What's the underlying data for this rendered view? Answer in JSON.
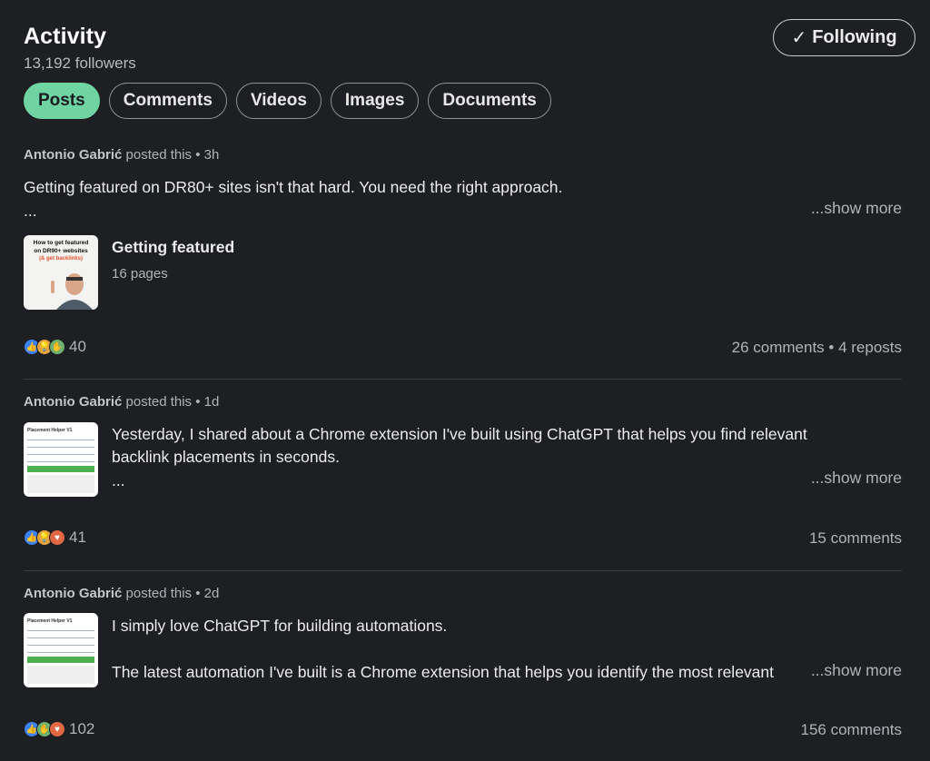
{
  "header": {
    "title": "Activity",
    "followers": "13,192 followers",
    "follow_label": "Following",
    "follow_check": "✓"
  },
  "tabs": [
    {
      "label": "Posts",
      "active": true
    },
    {
      "label": "Comments",
      "active": false
    },
    {
      "label": "Videos",
      "active": false
    },
    {
      "label": "Images",
      "active": false
    },
    {
      "label": "Documents",
      "active": false
    }
  ],
  "colors": {
    "background": "#1d1f23",
    "accent": "#6fd3a2",
    "like": "#3b82f6",
    "insightful": "#e7a33e",
    "support": "#6fb26f",
    "love": "#e16745"
  },
  "posts": [
    {
      "author": "Antonio Gabrić",
      "meta": "posted this • 3h",
      "text_line1": "Getting featured on DR80+ sites isn't that hard. You need the right approach.",
      "text_ellipsis": "...",
      "show_more": "...show more",
      "document": {
        "title": "Getting featured",
        "pages": "16 pages",
        "thumb_title_line1": "How to get featured",
        "thumb_title_line2": "on DR90+ websites",
        "thumb_subtitle": "(& get backlinks)"
      },
      "reactions": [
        "like",
        "insightful",
        "support"
      ],
      "reaction_count": "40",
      "stats": "26 comments • 4 reposts"
    },
    {
      "author": "Antonio Gabrić",
      "meta": "posted this • 1d",
      "text_line1": "Yesterday, I shared about a Chrome extension I've built using ChatGPT that helps you find relevant",
      "text_line2": "backlink placements in seconds.",
      "text_ellipsis": "...",
      "show_more": "...show more",
      "thumb_form_title": "Placement Helper V1",
      "reactions": [
        "like",
        "insightful",
        "love"
      ],
      "reaction_count": "41",
      "stats": "15 comments"
    },
    {
      "author": "Antonio Gabrić",
      "meta": "posted this • 2d",
      "text_line1": "I simply love ChatGPT for building automations.",
      "text_line2": "The latest automation I've built is a Chrome extension that helps you identify the most relevant",
      "show_more": "...show more",
      "thumb_form_title": "Placement Helper V1",
      "reactions": [
        "like",
        "support",
        "love"
      ],
      "reaction_count": "102",
      "stats": "156 comments"
    }
  ]
}
